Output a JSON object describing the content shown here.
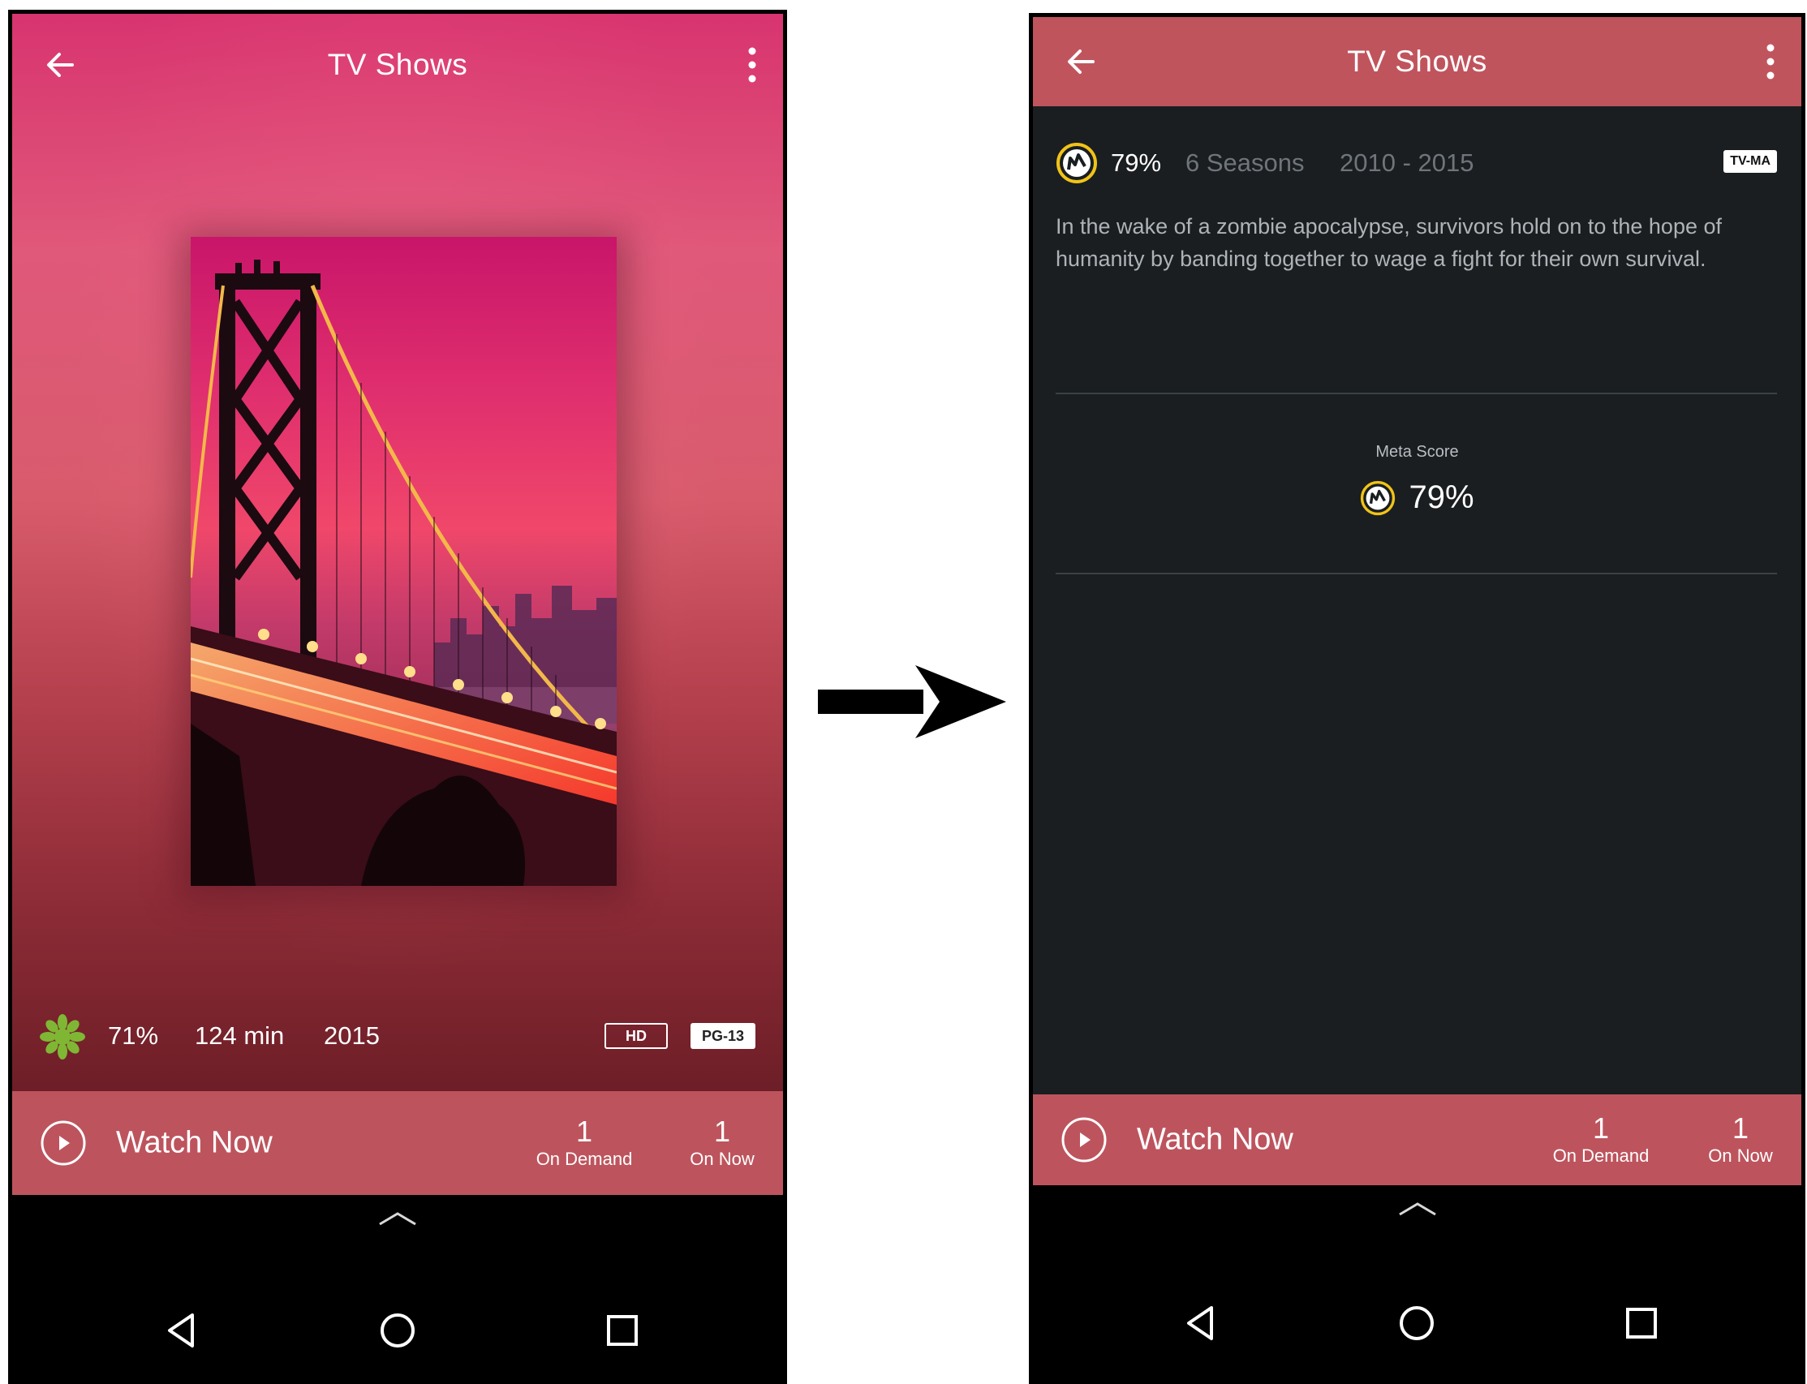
{
  "left_screen": {
    "app_bar": {
      "title": "TV Shows",
      "back_icon": "arrow-left-icon",
      "more_icon": "more-vert-icon"
    },
    "poster_description_icon": "bridge-poster",
    "info": {
      "rating_source_icon": "rotten-tomatoes-splat-icon",
      "score": "71%",
      "runtime": "124 min",
      "year": "2015",
      "quality_badge": "HD",
      "content_rating": "PG-13"
    },
    "watch_bar": {
      "play_icon": "play-circle-icon",
      "label": "Watch Now",
      "on_demand_count": "1",
      "on_demand_label": "On Demand",
      "on_now_count": "1",
      "on_now_label": "On Now"
    },
    "system_nav": {
      "chevron_icon": "chevron-up-icon",
      "back_icon": "nav-back-triangle-icon",
      "home_icon": "nav-home-circle-icon",
      "recents_icon": "nav-recents-square-icon"
    }
  },
  "right_screen": {
    "app_bar": {
      "title": "TV Shows",
      "back_icon": "arrow-left-icon",
      "more_icon": "more-vert-icon"
    },
    "meta": {
      "rating_source_icon": "metacritic-icon",
      "score": "79%",
      "seasons": "6 Seasons",
      "years": "2010 - 2015",
      "content_rating": "TV-MA"
    },
    "synopsis": "In the wake of a zombie apocalypse, survivors hold on to the hope of humanity by banding together to wage a fight for their own survival.",
    "metascore": {
      "label": "Meta Score",
      "value": "79%"
    },
    "watch_bar": {
      "play_icon": "play-circle-icon",
      "label": "Watch Now",
      "on_demand_count": "1",
      "on_demand_label": "On Demand",
      "on_now_count": "1",
      "on_now_label": "On Now"
    },
    "system_nav": {
      "chevron_icon": "chevron-up-icon",
      "back_icon": "nav-back-triangle-icon",
      "home_icon": "nav-home-circle-icon",
      "recents_icon": "nav-recents-square-icon"
    }
  },
  "transition_arrow_icon": "arrow-right-icon",
  "colors": {
    "accent_bar": "#bd545d",
    "dark_background": "#1a1e21",
    "left_gradient_top": "#d8346f",
    "left_gradient_bottom": "#6d1e27"
  }
}
